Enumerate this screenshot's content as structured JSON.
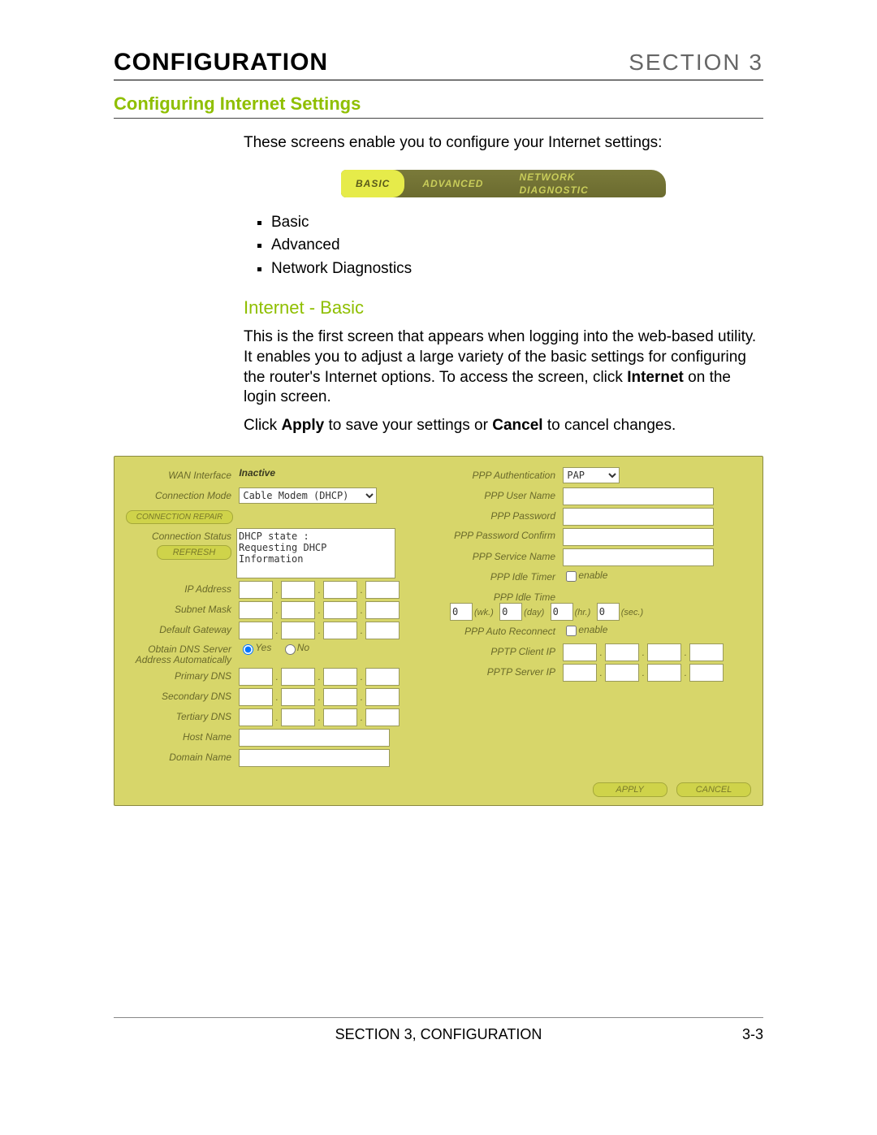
{
  "header": {
    "left": "CONFIGURATION",
    "right": "SECTION 3"
  },
  "section_title": "Configuring Internet Settings",
  "intro": "These screens enable you to configure your Internet settings:",
  "tabs": {
    "basic": "BASIC",
    "advanced": "ADVANCED",
    "diag": "NETWORK DIAGNOSTIC"
  },
  "bullets": [
    "Basic",
    "Advanced",
    "Network Diagnostics"
  ],
  "subheading": "Internet - Basic",
  "para1_a": "This is the first screen that appears when logging into the web-based utility. It enables you to adjust a large variety of the basic settings for configuring the router's Internet options. To access the screen, click ",
  "para1_bold": "Internet",
  "para1_b": " on the login screen.",
  "para2_a": "Click ",
  "para2_apply": "Apply",
  "para2_b": " to save your settings or ",
  "para2_cancel": "Cancel",
  "para2_c": " to cancel changes.",
  "panel": {
    "left": {
      "wan_iface": "WAN Interface",
      "wan_iface_val": "Inactive",
      "conn_mode": "Connection Mode",
      "conn_mode_val": "Cable Modem (DHCP)",
      "conn_repair_btn": "CONNECTION REPAIR",
      "conn_status": "Connection Status",
      "refresh_btn": "REFRESH",
      "status_text": "DHCP state :\nRequesting DHCP\nInformation",
      "ip_addr": "IP Address",
      "subnet": "Subnet Mask",
      "gw": "Default Gateway",
      "obtain_dns": "Obtain DNS Server Address Automatically",
      "yes": "Yes",
      "no": "No",
      "pri_dns": "Primary DNS",
      "sec_dns": "Secondary DNS",
      "ter_dns": "Tertiary DNS",
      "host": "Host Name",
      "domain": "Domain Name"
    },
    "right": {
      "ppp_auth": "PPP Authentication",
      "ppp_auth_val": "PAP",
      "ppp_user": "PPP User Name",
      "ppp_pwd": "PPP Password",
      "ppp_pwd_cfm": "PPP Password Confirm",
      "ppp_svc": "PPP Service Name",
      "ppp_idle_timer": "PPP Idle Timer",
      "enable": "enable",
      "ppp_idle_time": "PPP Idle Time",
      "idle": {
        "wk": "0",
        "wk_u": "(wk.)",
        "day": "0",
        "day_u": "(day)",
        "hr": "0",
        "hr_u": "(hr.)",
        "sec": "0",
        "sec_u": "(sec.)"
      },
      "ppp_auto": "PPP Auto Reconnect",
      "pptp_client": "PPTP Client IP",
      "pptp_server": "PPTP Server IP"
    },
    "buttons": {
      "apply": "APPLY",
      "cancel": "CANCEL"
    }
  },
  "footer": {
    "center": "SECTION 3, CONFIGURATION",
    "page": "3-3"
  }
}
